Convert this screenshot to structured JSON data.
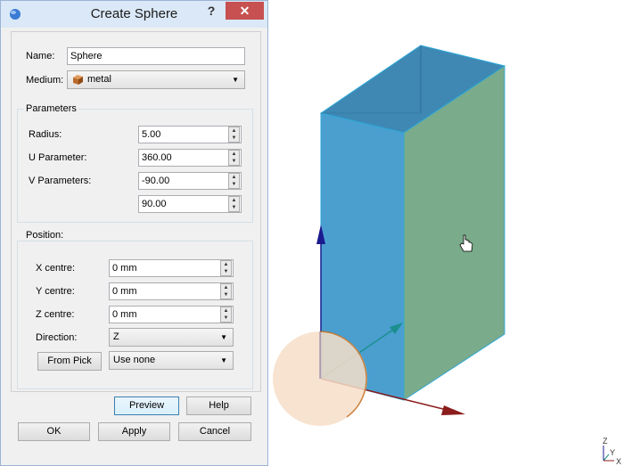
{
  "dialog": {
    "title": "Create Sphere",
    "help_label": "?",
    "close_label": "✕"
  },
  "form": {
    "name_label": "Name:",
    "name_value": "Sphere",
    "medium_label": "Medium:",
    "medium_value": "metal"
  },
  "parameters": {
    "group_title": "Parameters",
    "radius_label": "Radius:",
    "radius_value": "5.00",
    "u_label": "U Parameter:",
    "u_value": "360.00",
    "v_label": "V Parameters:",
    "v_value1": "-90.00",
    "v_value2": "90.00"
  },
  "position": {
    "group_title": "Position:",
    "x_label": "X centre:",
    "x_value": "0 mm",
    "y_label": "Y centre:",
    "y_value": "0 mm",
    "z_label": "Z centre:",
    "z_value": "0 mm",
    "direction_label": "Direction:",
    "direction_value": "Z",
    "from_pick_label": "From Pick",
    "pick_value": "Use none"
  },
  "buttons": {
    "preview": "Preview",
    "help": "Help",
    "ok": "OK",
    "apply": "Apply",
    "cancel": "Cancel"
  },
  "axis_labels": {
    "z": "Z",
    "y": "Y",
    "x": "X"
  },
  "colors": {
    "box_front": "#4a9fcf",
    "box_side": "#7aab8a",
    "box_top": "#3f88b4",
    "sphere": "#f6dec8",
    "z_axis": "#1b1b8f",
    "x_axis": "#8b1c1c",
    "y_axis": "#1b8f8f"
  }
}
